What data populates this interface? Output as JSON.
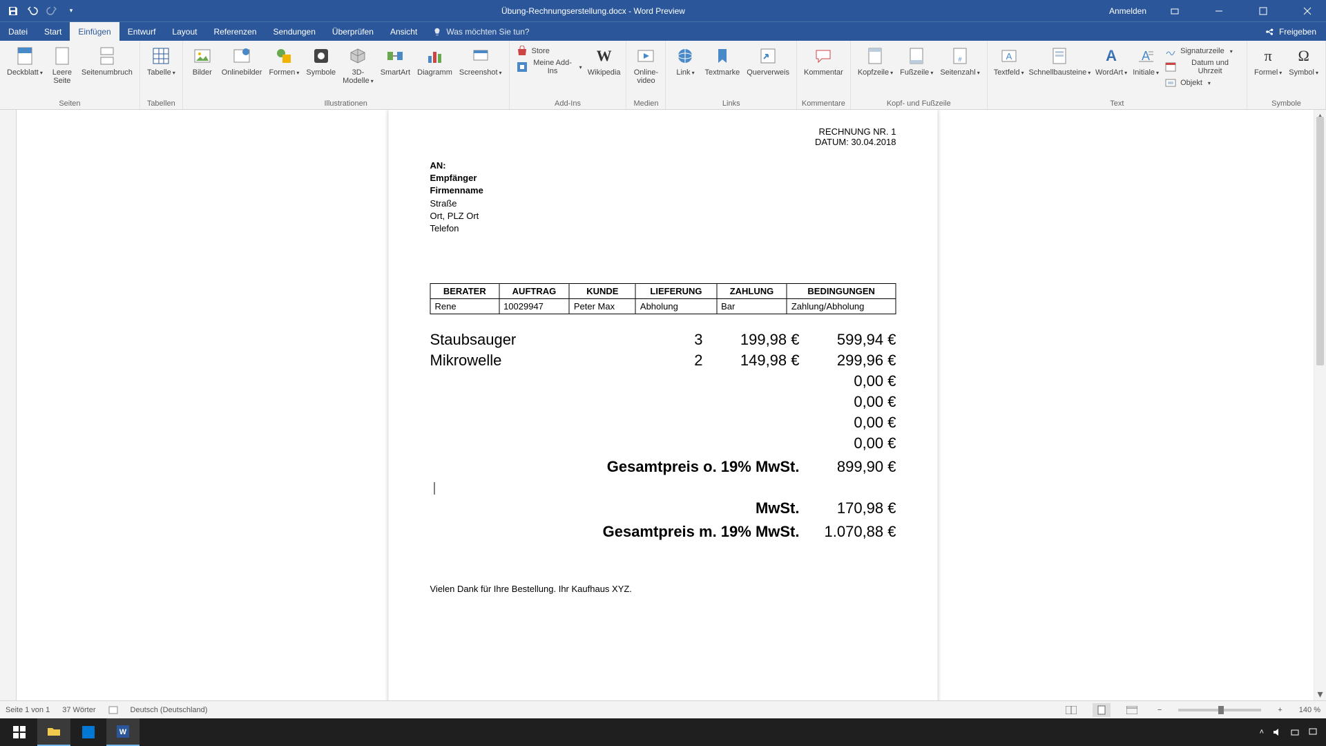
{
  "titlebar": {
    "document_title": "Übung-Rechnungserstellung.docx  -  Word Preview",
    "signin": "Anmelden"
  },
  "tabs": {
    "datei": "Datei",
    "start": "Start",
    "einfuegen": "Einfügen",
    "entwurf": "Entwurf",
    "layout": "Layout",
    "referenzen": "Referenzen",
    "sendungen": "Sendungen",
    "ueberpruefen": "Überprüfen",
    "ansicht": "Ansicht",
    "tellme_placeholder": "Was möchten Sie tun?",
    "freigeben": "Freigeben"
  },
  "ribbon": {
    "groups": {
      "seiten": "Seiten",
      "tabellen": "Tabellen",
      "illustrationen": "Illustrationen",
      "addins": "Add-Ins",
      "medien": "Medien",
      "links": "Links",
      "kommentare": "Kommentare",
      "kopf_fuss": "Kopf- und Fußzeile",
      "text": "Text",
      "symbole": "Symbole"
    },
    "buttons": {
      "deckblatt": "Deckblatt",
      "leere_seite": "Leere\nSeite",
      "seitenumbruch": "Seitenumbruch",
      "tabelle": "Tabelle",
      "bilder": "Bilder",
      "onlinebilder": "Onlinebilder",
      "formen": "Formen",
      "symbole_ico": "Symbole",
      "drei_d": "3D-\nModelle",
      "smartart": "SmartArt",
      "diagramm": "Diagramm",
      "screenshot": "Screenshot",
      "store": "Store",
      "meine_addins": "Meine Add-Ins",
      "wikipedia": "Wikipedia",
      "onlinevideo": "Online-\nvideo",
      "link": "Link",
      "textmarke": "Textmarke",
      "querverweis": "Querverweis",
      "kommentar": "Kommentar",
      "kopfzeile": "Kopfzeile",
      "fusszeile": "Fußzeile",
      "seitenzahl": "Seitenzahl",
      "textfeld": "Textfeld",
      "schnellbausteine": "Schnellbausteine",
      "wordart": "WordArt",
      "initiale": "Initiale",
      "signaturzeile": "Signaturzeile",
      "datum_uhrzeit": "Datum und Uhrzeit",
      "objekt": "Objekt",
      "formel": "Formel",
      "symbol": "Symbol"
    }
  },
  "document": {
    "inv_no_label": "RECHNUNG NR. 1",
    "date_label": "DATUM: 30.04.2018",
    "an": "AN:",
    "empfaenger": "Empfänger",
    "firmenname": "Firmenname",
    "strasse": "Straße",
    "ort_plz": "Ort, PLZ Ort",
    "telefon": "Telefon",
    "meta_headers": [
      "BERATER",
      "AUFTRAG",
      "KUNDE",
      "LIEFERUNG",
      "ZAHLUNG",
      "BEDINGUNGEN"
    ],
    "meta_row": [
      "Rene",
      "10029947",
      "Peter Max",
      "Abholung",
      "Bar",
      "Zahlung/Abholung"
    ],
    "items": [
      {
        "name": "Staubsauger",
        "qty": "3",
        "unit": "199,98 €",
        "total": "599,94 €"
      },
      {
        "name": "Mikrowelle",
        "qty": "2",
        "unit": "149,98 €",
        "total": "299,96 €"
      },
      {
        "name": "",
        "qty": "",
        "unit": "",
        "total": "0,00 €"
      },
      {
        "name": "",
        "qty": "",
        "unit": "",
        "total": "0,00 €"
      },
      {
        "name": "",
        "qty": "",
        "unit": "",
        "total": "0,00 €"
      },
      {
        "name": "",
        "qty": "",
        "unit": "",
        "total": "0,00 €"
      }
    ],
    "sum_labels": {
      "net": "Gesamtpreis o. 19% MwSt.",
      "vat": "MwSt.",
      "gross": "Gesamtpreis m. 19% MwSt."
    },
    "sum_values": {
      "net": "899,90 €",
      "vat": "170,98 €",
      "gross": "1.070,88 €"
    },
    "thanks": "Vielen Dank für Ihre Bestellung. Ihr Kaufhaus XYZ."
  },
  "statusbar": {
    "page": "Seite 1 von 1",
    "words": "37 Wörter",
    "lang": "Deutsch (Deutschland)",
    "zoom": "140 %"
  },
  "taskbar": {
    "time": "",
    "date": ""
  }
}
